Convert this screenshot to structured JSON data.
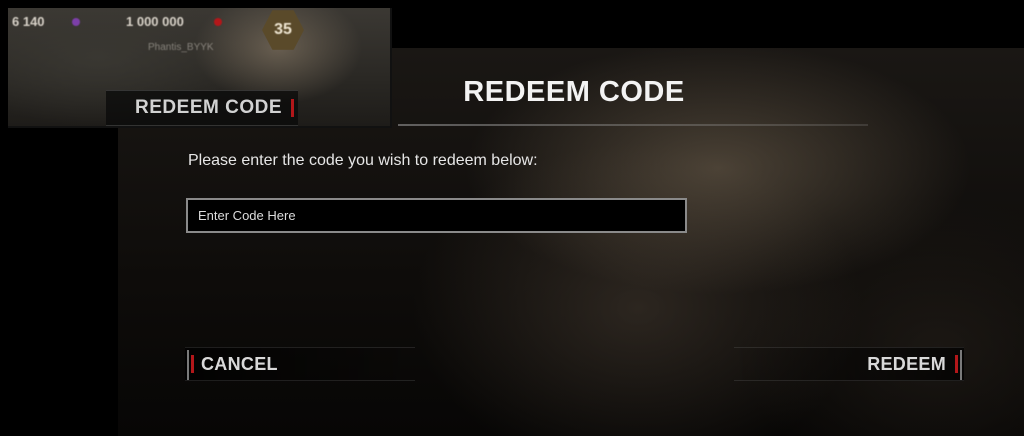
{
  "inset": {
    "stat_1": "6 140",
    "stat_2": "1 000 000",
    "level_badge": "35",
    "player_name": "Phantis_BYYK",
    "redeem_button_label": "REDEEM CODE"
  },
  "dialog": {
    "title": "REDEEM CODE",
    "prompt": "Please enter the code you wish to redeem below:",
    "code_input": {
      "value": "",
      "placeholder": "Enter Code Here"
    },
    "cancel_label": "CANCEL",
    "redeem_label": "REDEEM"
  },
  "colors": {
    "accent_red": "#b3171a",
    "text_primary": "#f3f3f3",
    "input_border": "#8a8a8a"
  }
}
